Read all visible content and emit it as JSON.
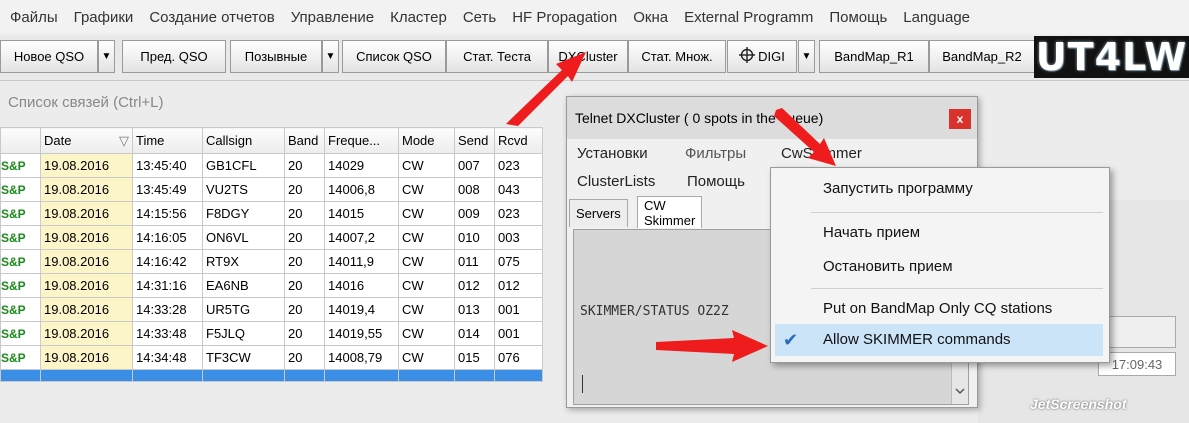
{
  "menubar": {
    "items": [
      "Файлы",
      "Графики",
      "Создание отчетов",
      "Управление",
      "Кластер",
      "Сеть",
      "HF Propagation",
      "Окна",
      "External Programm",
      "Помощь",
      "Language"
    ]
  },
  "toolbar": {
    "new_qso": "Новое QSO",
    "prev_qso": "Пред. QSO",
    "callsigns": "Позывные",
    "qso_list": "Список QSO",
    "contest_stats": "Стат. Теста",
    "dxcluster": "DXCluster",
    "mult_stats": "Стат. Множ.",
    "digi": "DIGI",
    "bandmap_r1": "BandMap_R1",
    "bandmap_r2": "BandMap_R2",
    "logo": "UT4LW",
    "dropdown_glyph": "▼",
    "digi_icon": "crosshair-icon"
  },
  "log": {
    "title": "Список связей (Ctrl+L)",
    "columns": [
      "Date",
      "Time",
      "Callsign",
      "Band",
      "Freque...",
      "Mode",
      "Send",
      "Rcvd"
    ],
    "sort_glyph": "▽",
    "marker": "S&P",
    "rows": [
      {
        "date": "19.08.2016",
        "time": "13:45:40",
        "call": "GB1CFL",
        "band": "20",
        "freq": "14029",
        "mode": "CW",
        "send": "007",
        "rcvd": "023"
      },
      {
        "date": "19.08.2016",
        "time": "13:45:49",
        "call": "VU2TS",
        "band": "20",
        "freq": "14006,8",
        "mode": "CW",
        "send": "008",
        "rcvd": "043"
      },
      {
        "date": "19.08.2016",
        "time": "14:15:56",
        "call": "F8DGY",
        "band": "20",
        "freq": "14015",
        "mode": "CW",
        "send": "009",
        "rcvd": "023"
      },
      {
        "date": "19.08.2016",
        "time": "14:16:05",
        "call": "ON6VL",
        "band": "20",
        "freq": "14007,2",
        "mode": "CW",
        "send": "010",
        "rcvd": "003"
      },
      {
        "date": "19.08.2016",
        "time": "14:16:42",
        "call": "RT9X",
        "band": "20",
        "freq": "14011,9",
        "mode": "CW",
        "send": "011",
        "rcvd": "075"
      },
      {
        "date": "19.08.2016",
        "time": "14:31:16",
        "call": "EA6NB",
        "band": "20",
        "freq": "14016",
        "mode": "CW",
        "send": "012",
        "rcvd": "012"
      },
      {
        "date": "19.08.2016",
        "time": "14:33:28",
        "call": "UR5TG",
        "band": "20",
        "freq": "14019,4",
        "mode": "CW",
        "send": "013",
        "rcvd": "001"
      },
      {
        "date": "19.08.2016",
        "time": "14:33:48",
        "call": "F5JLQ",
        "band": "20",
        "freq": "14019,55",
        "mode": "CW",
        "send": "014",
        "rcvd": "001"
      },
      {
        "date": "19.08.2016",
        "time": "14:34:48",
        "call": "TF3CW",
        "band": "20",
        "freq": "14008,79",
        "mode": "CW",
        "send": "015",
        "rcvd": "076"
      }
    ]
  },
  "telnet": {
    "title": "Telnet DXCluster ( 0 spots in the queue)",
    "close": "x",
    "menu": {
      "settings": "Установки",
      "filters": "Фильтры",
      "cwskimmer": "CwSkimmer",
      "clusterlists": "ClusterLists",
      "help": "Помощь"
    },
    "tabs": [
      "Servers",
      "CW Skimmer"
    ],
    "console_text": "SKIMMER/STATUS OZ2Z"
  },
  "context_menu": {
    "items": {
      "start_program": "Запустить программу",
      "start_receive": "Начать прием",
      "stop_receive": "Остановить прием",
      "bandmap_cq": "Put on BandMap Only CQ stations",
      "allow_skimmer": "Allow SKIMMER commands"
    },
    "checked_icon": "checkmark-icon",
    "check_glyph": "✔"
  },
  "right_panel": {
    "time_value": "17:09:43",
    "watermark": "JetScreenshot"
  },
  "colors": {
    "marker_green": "#1a8a1a",
    "selection_blue": "#3a8ee6",
    "close_red": "#d9322c",
    "arrow_red": "#ee1c1c"
  }
}
